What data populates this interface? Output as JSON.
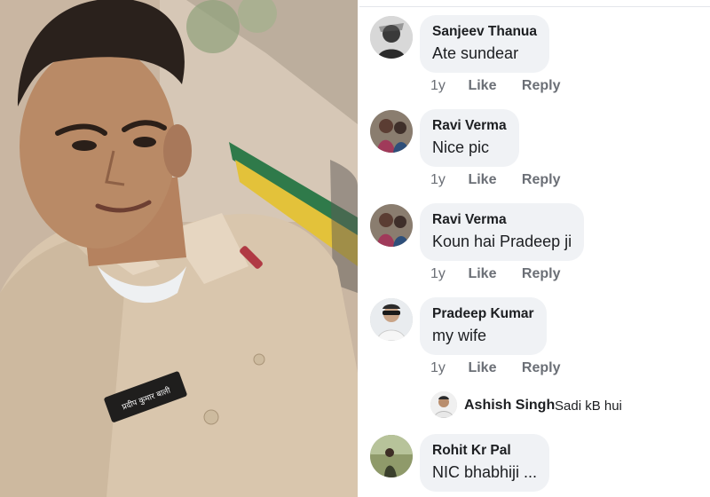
{
  "photo": {
    "badge_text": "प्रदीप कुमार बाली"
  },
  "comments": [
    {
      "author": "Sanjeev Thanua",
      "text": "Ate sundear",
      "time": "1y",
      "like": "Like",
      "reply": "Reply"
    },
    {
      "author": "Ravi Verma",
      "text": "Nice pic",
      "time": "1y",
      "like": "Like",
      "reply": "Reply"
    },
    {
      "author": "Ravi Verma",
      "text": "Koun hai Pradeep ji",
      "time": "1y",
      "like": "Like",
      "reply": "Reply"
    },
    {
      "author": "Pradeep Kumar",
      "text": "my wife",
      "time": "1y",
      "like": "Like",
      "reply": "Reply"
    }
  ],
  "nested_reply": {
    "author": "Ashish Singh",
    "text": "Sadi kB hui"
  },
  "last_comment": {
    "author": "Rohit Kr Pal",
    "text": "NIC bhabhiji ..."
  }
}
